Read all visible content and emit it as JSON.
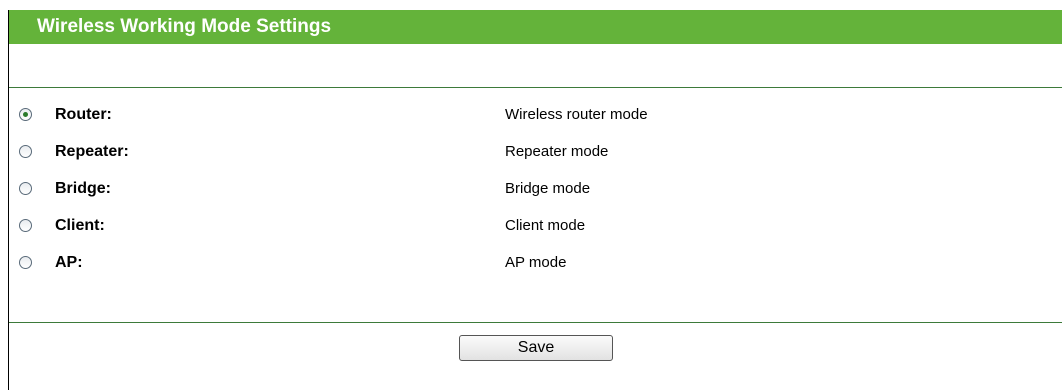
{
  "header": {
    "title": "Wireless Working Mode Settings",
    "bar_color": "#64b33a"
  },
  "modes": [
    {
      "label": "Router:",
      "description": "Wireless router mode",
      "selected": true
    },
    {
      "label": "Repeater:",
      "description": "Repeater mode",
      "selected": false
    },
    {
      "label": "Bridge:",
      "description": "Bridge mode",
      "selected": false
    },
    {
      "label": "Client:",
      "description": "Client mode",
      "selected": false
    },
    {
      "label": "AP:",
      "description": "AP mode",
      "selected": false
    }
  ],
  "actions": {
    "save_label": "Save"
  },
  "colors": {
    "divider": "#3d7a3a",
    "radio_selected": "#2b7a2b"
  }
}
